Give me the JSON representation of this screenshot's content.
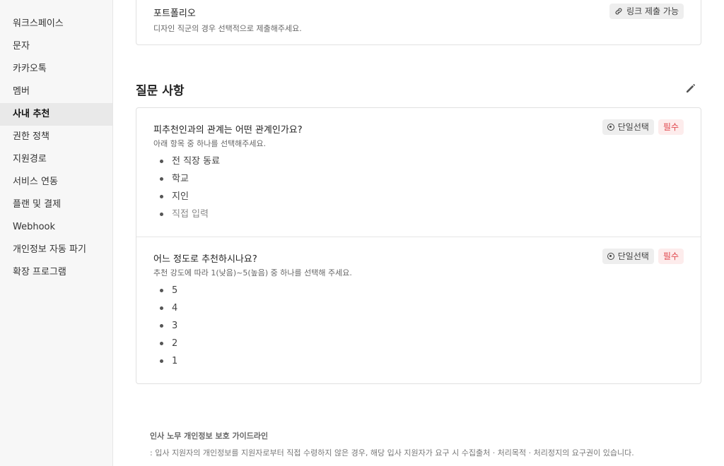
{
  "sidebar": {
    "items": [
      {
        "label": "워크스페이스"
      },
      {
        "label": "문자"
      },
      {
        "label": "카카오톡"
      },
      {
        "label": "멤버"
      },
      {
        "label": "사내 추천",
        "active": true
      },
      {
        "label": "권한 정책"
      },
      {
        "label": "지원경로"
      },
      {
        "label": "서비스 연동"
      },
      {
        "label": "플랜 및 결제"
      },
      {
        "label": "Webhook"
      },
      {
        "label": "개인정보 자동 파기"
      },
      {
        "label": "확장 프로그램"
      }
    ]
  },
  "portfolio": {
    "title": "포트폴리오",
    "desc": "디자인 직군의 경우 선택적으로 제출해주세요.",
    "badge": "링크 제출 가능",
    "badge_icon": "link-icon"
  },
  "questions_section": {
    "title": "질문 사항",
    "edit_icon": "pencil-icon"
  },
  "questions": [
    {
      "title": "피추천인과의 관계는 어떤 관계인가요?",
      "desc": "아래 항목 중 하나를 선택해주세요.",
      "type_badge": "단일선택",
      "required_badge": "필수",
      "options": [
        "전 직장 동료",
        "학교",
        "지인"
      ],
      "free_input": "직접 입력"
    },
    {
      "title": "어느 정도로 추천하시나요?",
      "desc": "추천 강도에 따라 1(낮음)~5(높음) 중 하나를 선택해 주세요.",
      "type_badge": "단일선택",
      "required_badge": "필수",
      "options": [
        "5",
        "4",
        "3",
        "2",
        "1"
      ]
    }
  ],
  "footer": {
    "title": "인사 노무 개인정보 보호 가이드라인",
    "text": ": 입사 지원자의 개인정보를 지원자로부터 직접 수령하지 않은 경우, 해당 입사 지원자가 요구 시 수집출처 · 처리목적 · 처리정지의 요구권이 있습니다."
  },
  "colors": {
    "required": "#e0474d",
    "sidebar_bg": "#f7f7f7",
    "active_item_bg": "#e9e9e9"
  }
}
